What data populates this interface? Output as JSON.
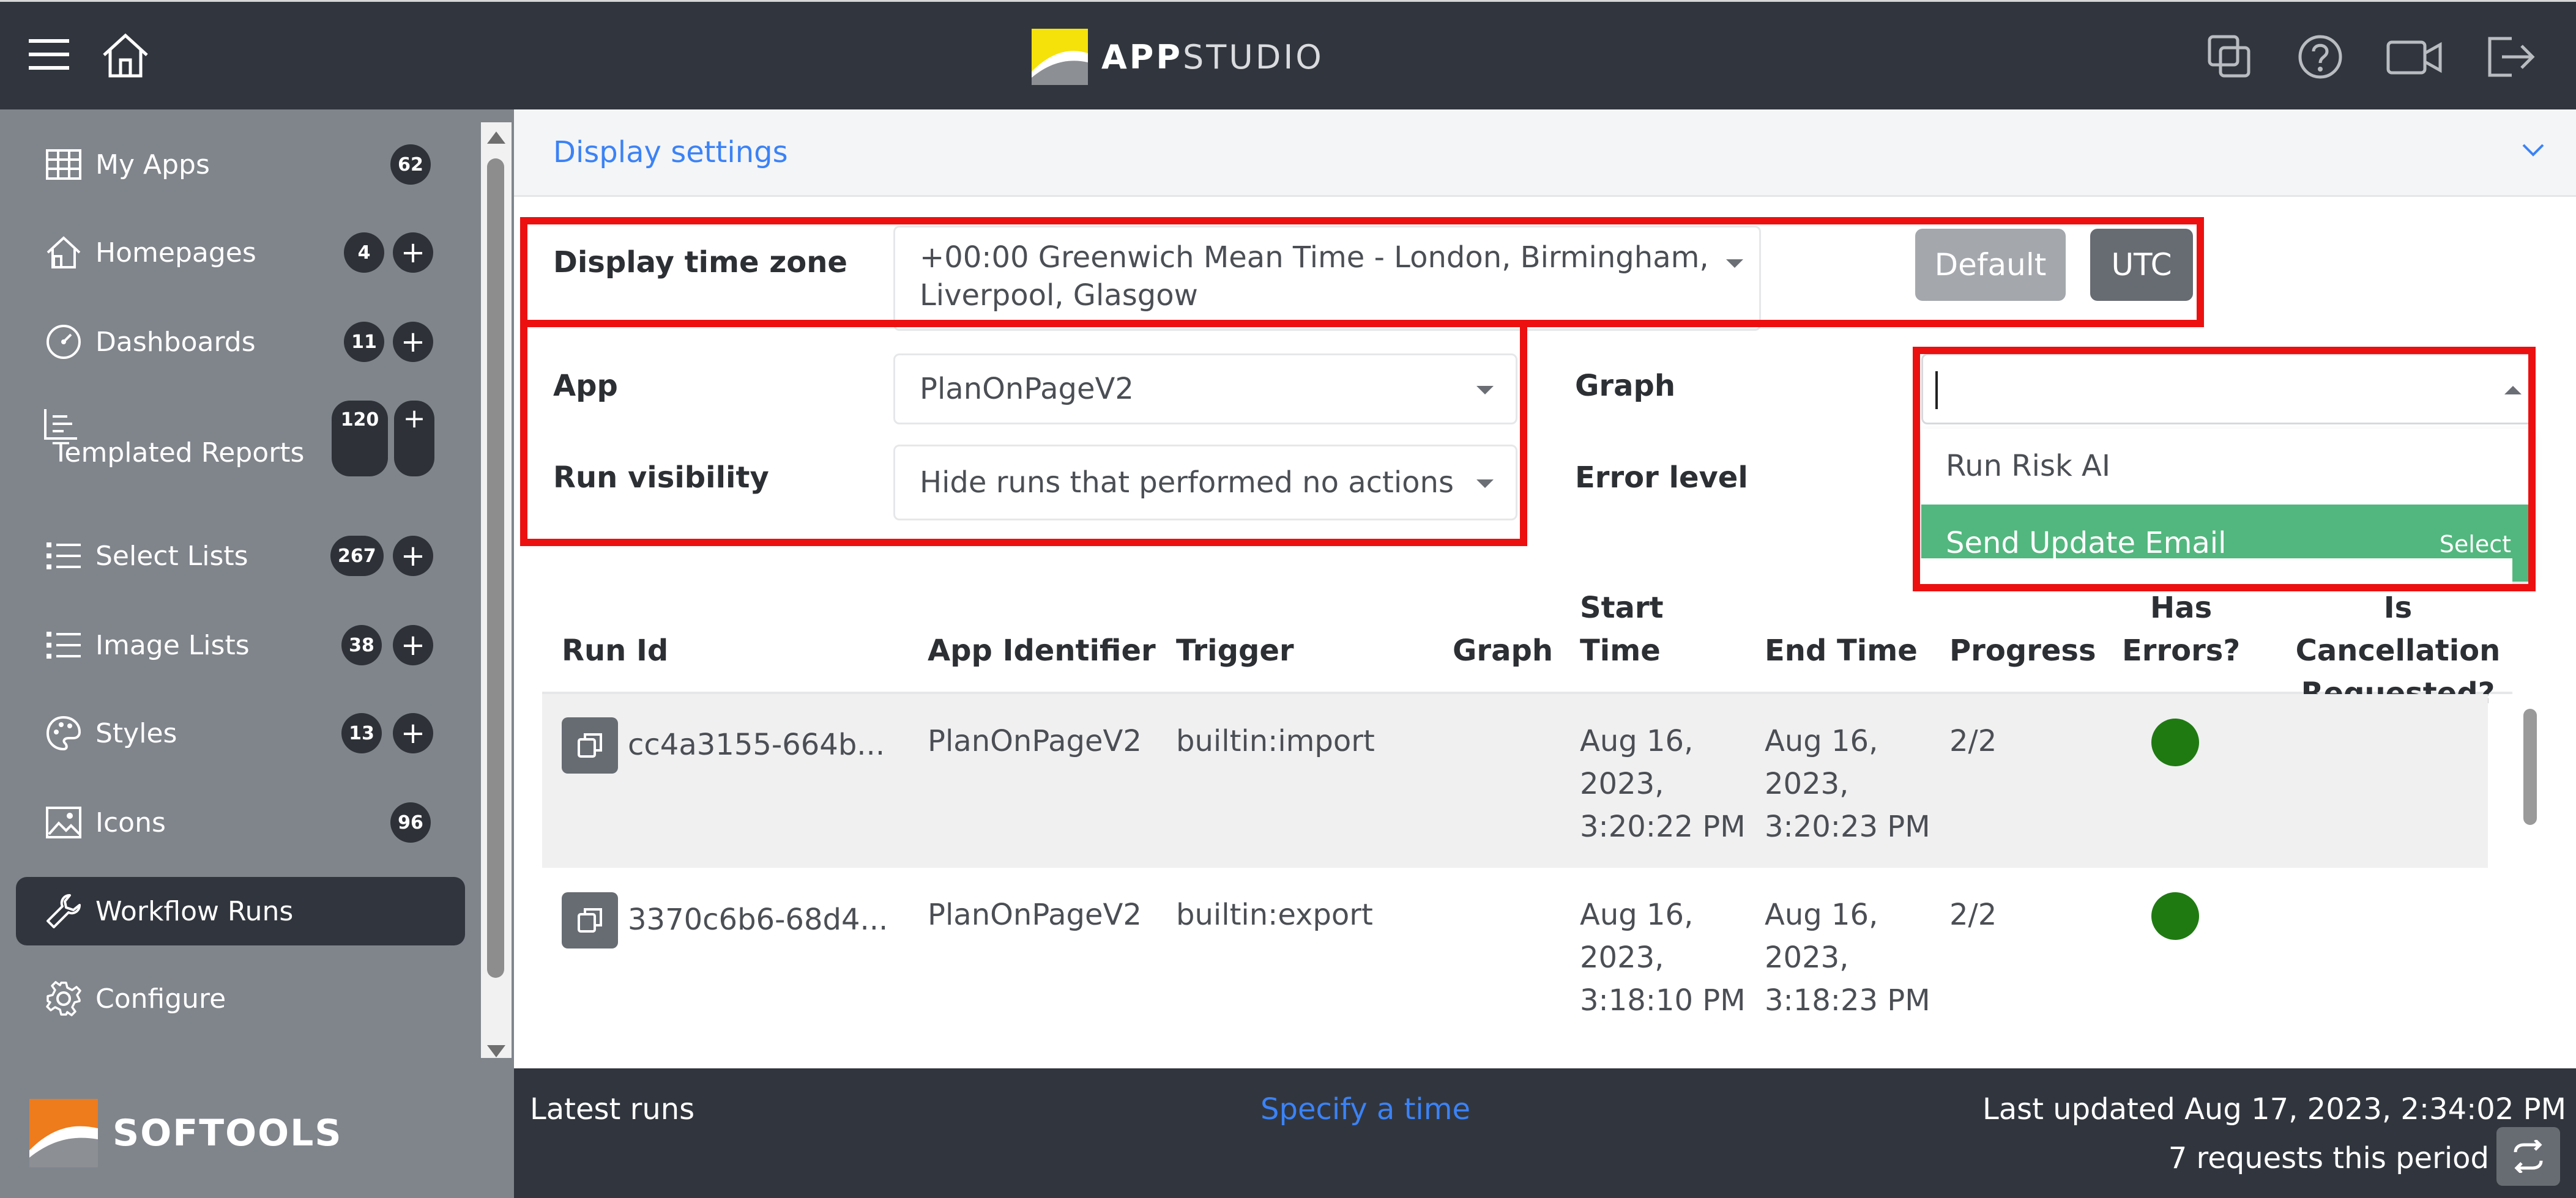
{
  "app": {
    "title": "APPSTUDIO",
    "title_bold": "APP",
    "title_light": "STUDIO"
  },
  "sidebar": {
    "items": [
      {
        "label": "My Apps",
        "count": "62",
        "icon": "grid-icon"
      },
      {
        "label": "Homepages",
        "count": "4",
        "icon": "home-icon"
      },
      {
        "label": "Dashboards",
        "count": "11",
        "icon": "gauge-icon"
      },
      {
        "label": "Templated Reports",
        "count": "120",
        "icon": "report-icon"
      },
      {
        "label": "Select Lists",
        "count": "267",
        "icon": "list-icon"
      },
      {
        "label": "Image Lists",
        "count": "38",
        "icon": "list-icon"
      },
      {
        "label": "Styles",
        "count": "13",
        "icon": "palette-icon"
      },
      {
        "label": "Icons",
        "count": "96",
        "icon": "image-icon"
      },
      {
        "label": "Workflow Runs",
        "icon": "wrench-icon"
      },
      {
        "label": "Configure",
        "icon": "gear-icon"
      }
    ],
    "add_symbol": "+",
    "brand": "SOFTOOLS"
  },
  "display_settings": {
    "title": "Display settings"
  },
  "filters": {
    "timezone_label": "Display time zone",
    "timezone_value_line1": "+00:00 Greenwich Mean Time - London, Birmingham,",
    "timezone_value_line2": "Liverpool, Glasgow",
    "default_button": "Default",
    "utc_button": "UTC",
    "app_label": "App",
    "app_value": "PlanOnPageV2",
    "graph_label": "Graph",
    "graph_value": "",
    "run_visibility_label": "Run visibility",
    "run_visibility_value": "Hide runs that performed no actions",
    "error_level_label": "Error level"
  },
  "graph_dropdown": {
    "options": [
      {
        "label": "Run Risk AI"
      },
      {
        "label": "Send Update Email",
        "hint": "Select"
      }
    ]
  },
  "table": {
    "headers": {
      "run_id": "Run Id",
      "app_identifier": "App Identifier",
      "trigger": "Trigger",
      "graph": "Graph",
      "start_time_1": "Start",
      "start_time_2": "Time",
      "end_time": "End Time",
      "progress": "Progress",
      "has_errors_1": "Has",
      "has_errors_2": "Errors?",
      "cancel_1": "Is Cancellation",
      "cancel_2": "Requested?"
    },
    "rows": [
      {
        "run_id": "cc4a3155-664b...",
        "app_identifier": "PlanOnPageV2",
        "trigger": "builtin:import",
        "graph": "",
        "start_1": "Aug 16,",
        "start_2": "2023,",
        "start_3": "3:20:22 PM",
        "end_1": "Aug 16,",
        "end_2": "2023,",
        "end_3": "3:20:23 PM",
        "progress": "2/2",
        "status_color": "#1f7a12"
      },
      {
        "run_id": "3370c6b6-68d4...",
        "app_identifier": "PlanOnPageV2",
        "trigger": "builtin:export",
        "graph": "",
        "start_1": "Aug 16,",
        "start_2": "2023,",
        "start_3": "3:18:10 PM",
        "end_1": "Aug 16,",
        "end_2": "2023,",
        "end_3": "3:18:23 PM",
        "progress": "2/2",
        "status_color": "#1f7a12"
      }
    ]
  },
  "footer": {
    "latest_runs": "Latest runs",
    "specify_time": "Specify a time",
    "last_updated": "Last updated Aug 17, 2023, 2:34:02 PM",
    "requests": "7 requests this period"
  },
  "colors": {
    "topbar": "#31363e",
    "sidebar": "#80858c",
    "accent_link": "#3b82f6",
    "selected_option": "#52b77e",
    "highlight_border": "#ec1010",
    "success": "#1f7a12"
  }
}
